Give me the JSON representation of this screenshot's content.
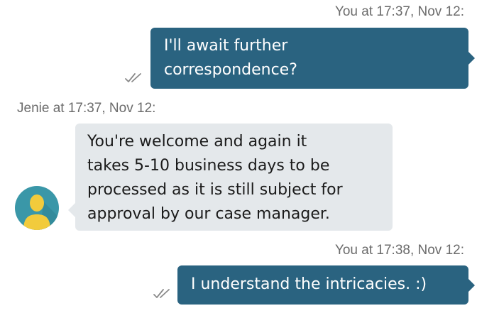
{
  "messages": [
    {
      "sender": "You",
      "meta": "You at 17:37, Nov 12:",
      "lines": [
        "I'll await further",
        "correspondence?"
      ],
      "direction": "outgoing",
      "status_icon": "double-check-icon"
    },
    {
      "sender": "Jenie",
      "meta": "Jenie at 17:37, Nov 12:",
      "lines": [
        "You're welcome and again it",
        "takes 5-10 business days to be",
        "processed as it is still subject for",
        "approval by our case manager."
      ],
      "direction": "incoming",
      "avatar_icon": "user-avatar-icon"
    },
    {
      "sender": "You",
      "meta": "You at 17:38, Nov 12:",
      "lines": [
        "I understand the intricacies. :)"
      ],
      "direction": "outgoing",
      "status_icon": "double-check-icon"
    }
  ],
  "colors": {
    "outgoing_bubble": "#2a6380",
    "incoming_bubble": "#e4e8eb",
    "avatar_bg": "#3a97a8",
    "avatar_figure": "#f2cb3c",
    "meta_text": "#6b6b6b"
  }
}
